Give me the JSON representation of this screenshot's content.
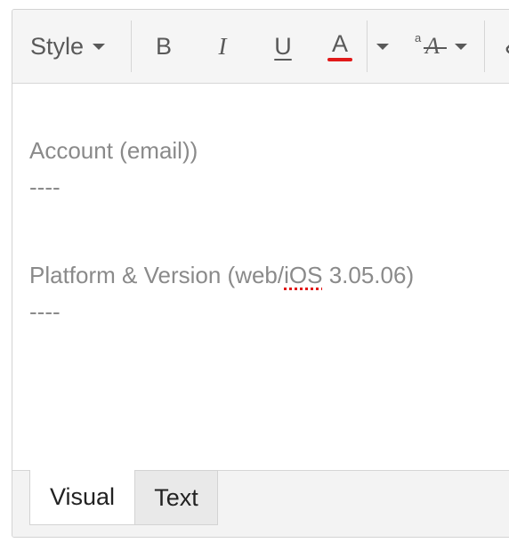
{
  "toolbar": {
    "style_label": "Style",
    "bold_label": "B",
    "italic_label": "I",
    "underline_label": "U",
    "text_color_label": "A",
    "clear_small_label": "a",
    "clear_big_label": "A",
    "text_color": "#e11919"
  },
  "content": {
    "line1": "Account (email))",
    "line2": "----",
    "line3_before": "Platform & Version (web/",
    "line3_misspelled": "iOS",
    "line3_after": " 3.05.06)",
    "line4": "----"
  },
  "tabs": {
    "visual_label": "Visual",
    "text_label": "Text"
  }
}
